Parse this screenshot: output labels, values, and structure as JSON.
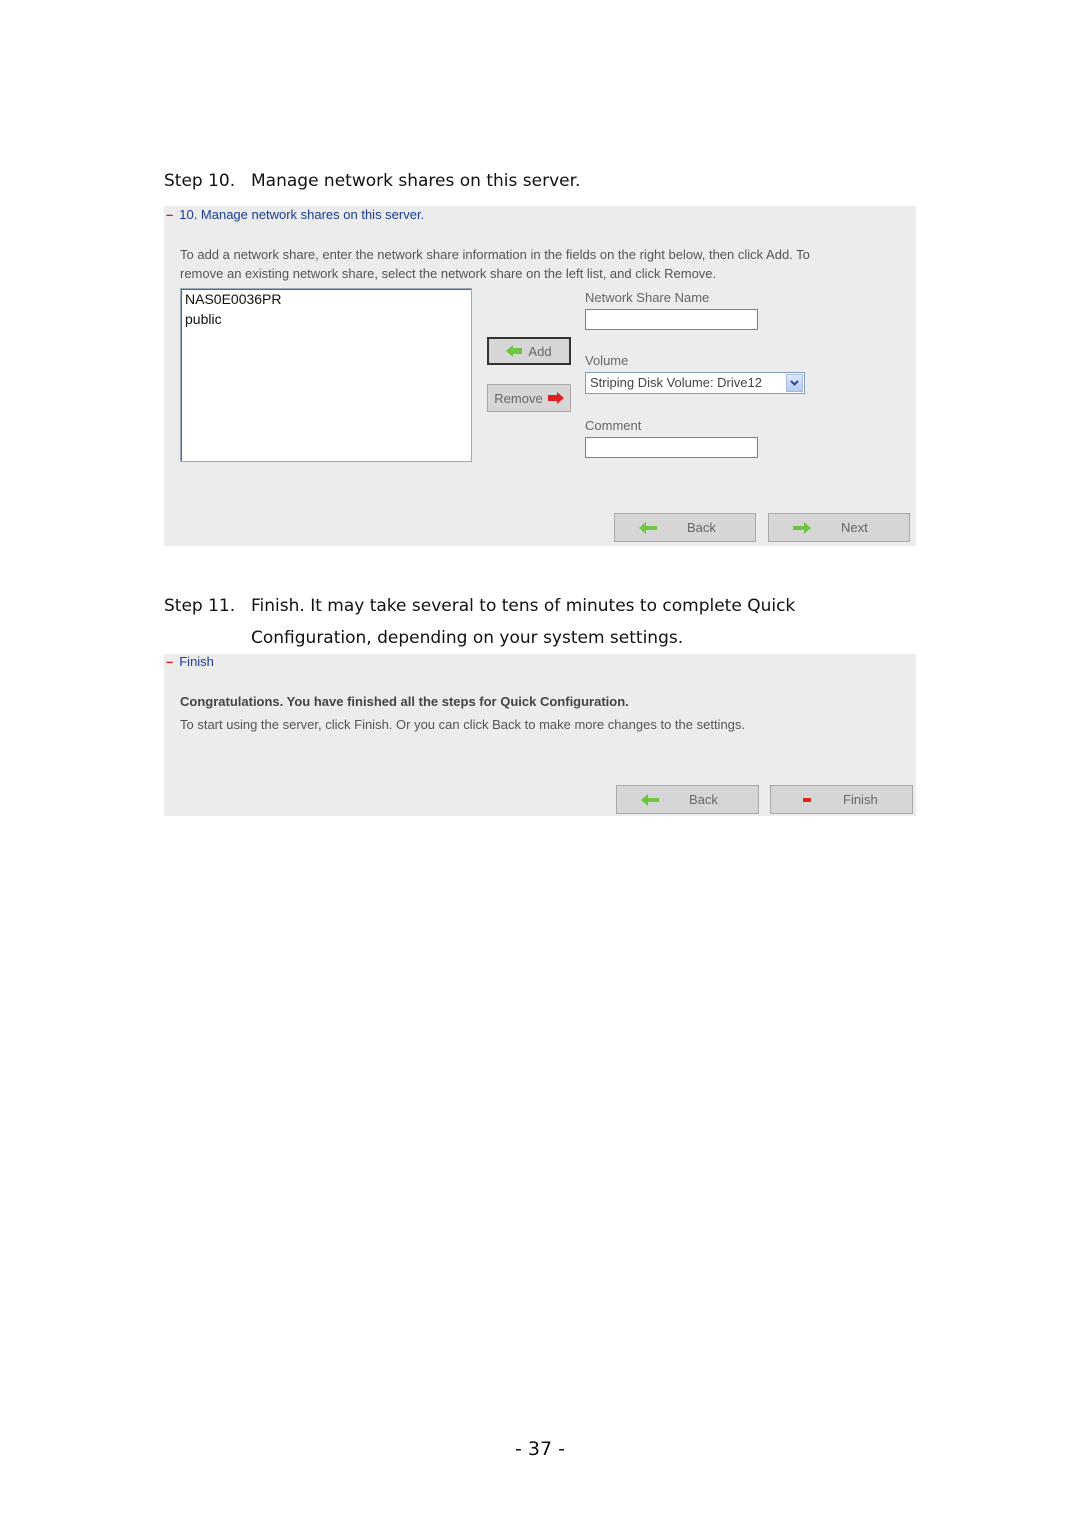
{
  "step10": {
    "number": "Step 10.",
    "heading": "Manage network shares on this server.",
    "panel": {
      "title_dash": "–",
      "title": "10. Manage network shares on this server.",
      "description_lines": [
        "To add a network share, enter the network share information in the fields on the right below, then click Add. To",
        "remove an existing network share, select the network share on the left list, and click Remove."
      ],
      "share_list": [
        "NAS0E0036PR",
        "public"
      ],
      "add_label": "Add",
      "remove_label": "Remove",
      "network_share_name_label": "Network Share Name",
      "network_share_name_value": "",
      "volume_label": "Volume",
      "volume_selected": "Striping Disk Volume: Drive12",
      "comment_label": "Comment",
      "comment_value": "",
      "back_label": "Back",
      "next_label": "Next"
    }
  },
  "step11": {
    "number": "Step 11.",
    "heading_line1": "Finish.  It may take several to tens of minutes to complete Quick",
    "heading_line2": "Configuration, depending on your system settings.",
    "panel": {
      "title_dash": "–",
      "title": "Finish",
      "congrats": "Congratulations. You have finished all the steps for Quick Configuration.",
      "instructions": "To start using the server, click Finish. Or you can click Back to make more changes to the settings.",
      "back_label": "Back",
      "finish_label": "Finish"
    }
  },
  "colors": {
    "panel_bg": "#ececec",
    "title_blue": "#1a3d8f",
    "dash_red": "#e0201c",
    "arrow_green": "#6cc644",
    "arrow_red": "#e02020"
  },
  "page_number": "- 37 -"
}
